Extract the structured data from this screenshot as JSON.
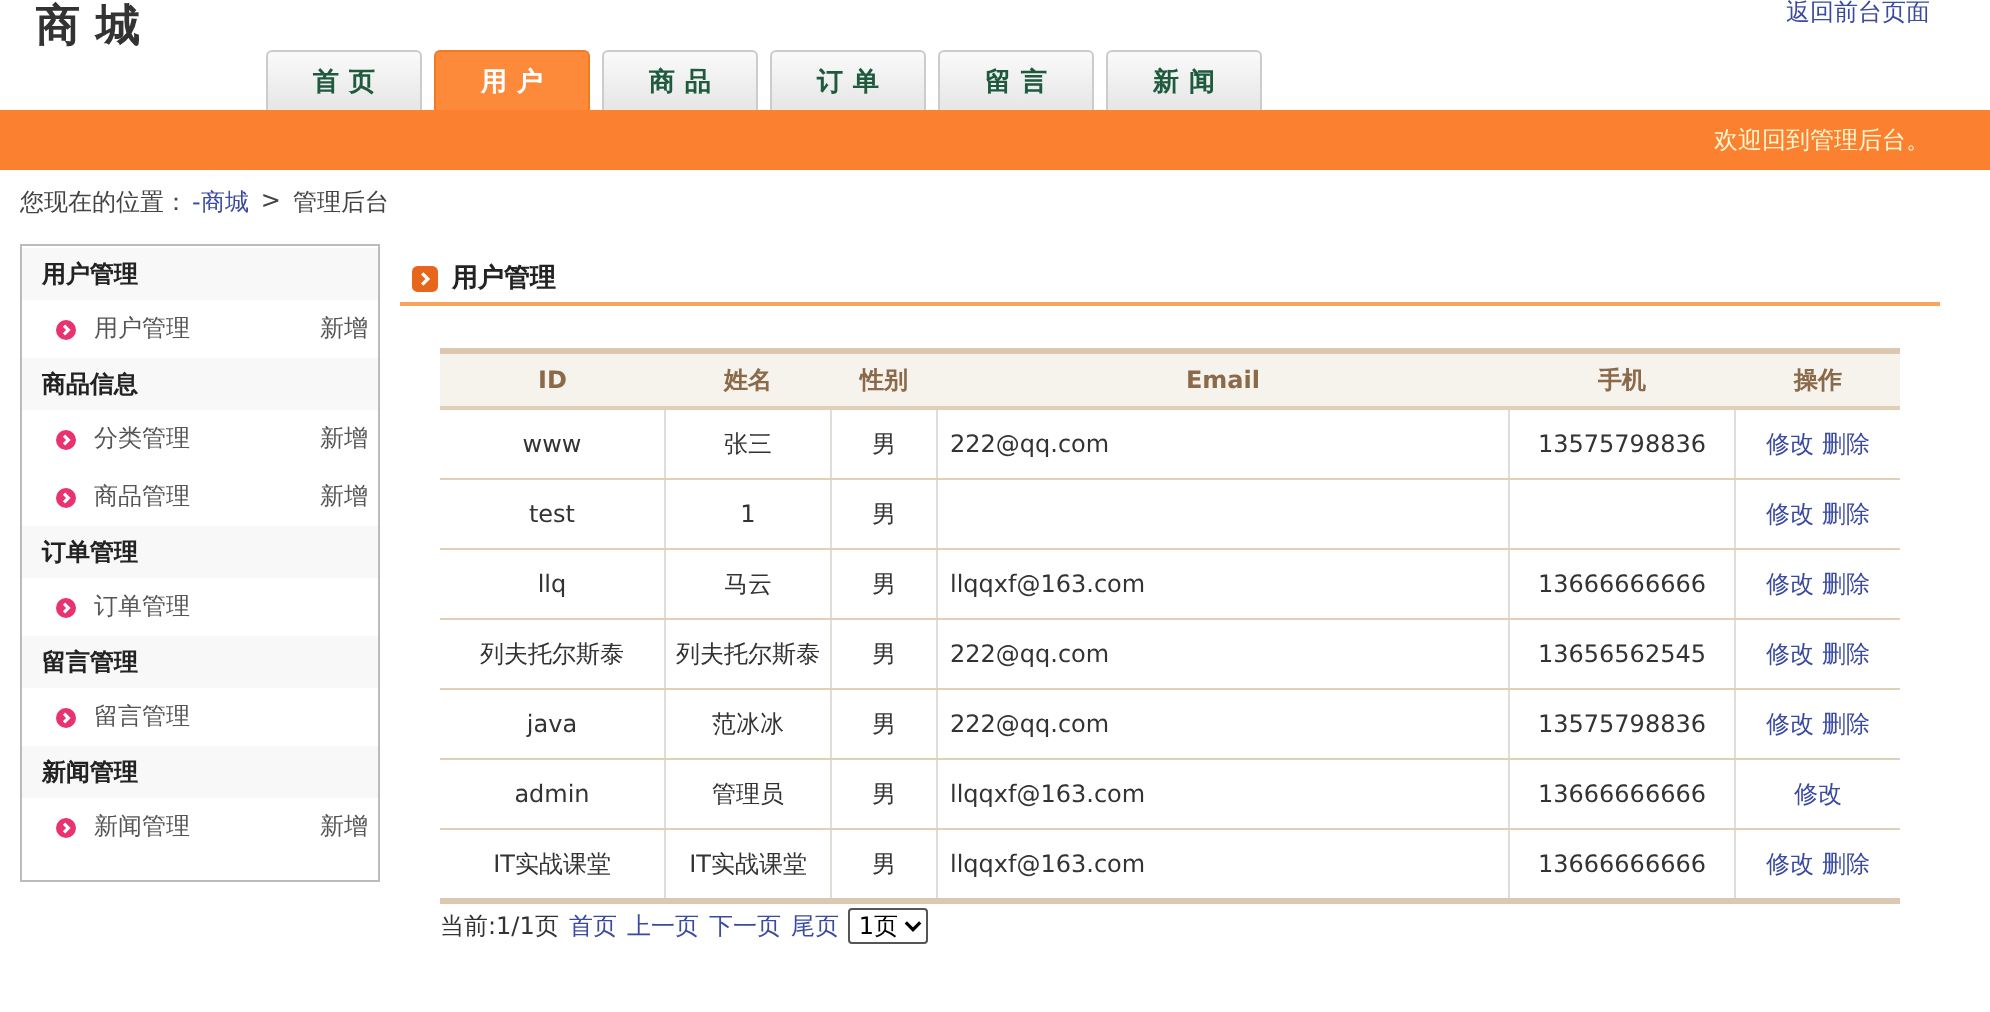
{
  "logo": "商城",
  "top_link": "返回前台页面",
  "tabs": [
    {
      "label": "首 页",
      "selected": false
    },
    {
      "label": "用 户",
      "selected": true
    },
    {
      "label": "商 品",
      "selected": false
    },
    {
      "label": "订 单",
      "selected": false
    },
    {
      "label": "留 言",
      "selected": false
    },
    {
      "label": "新 闻",
      "selected": false
    }
  ],
  "welcome": "欢迎回到管理后台。",
  "breadcrumb": {
    "prefix": "您现在的位置：",
    "link": "-商城",
    "separator": ">",
    "current": "管理后台"
  },
  "sidebar": [
    {
      "title": "用户管理",
      "items": [
        {
          "label": "用户管理",
          "action": "新增"
        }
      ]
    },
    {
      "title": "商品信息",
      "items": [
        {
          "label": "分类管理",
          "action": "新增"
        },
        {
          "label": "商品管理",
          "action": "新增"
        }
      ]
    },
    {
      "title": "订单管理",
      "items": [
        {
          "label": "订单管理"
        }
      ]
    },
    {
      "title": "留言管理",
      "items": [
        {
          "label": "留言管理"
        }
      ]
    },
    {
      "title": "新闻管理",
      "items": [
        {
          "label": "新闻管理",
          "action": "新增"
        }
      ]
    }
  ],
  "section_title": "用户管理",
  "table": {
    "columns": [
      "ID",
      "姓名",
      "性别",
      "Email",
      "手机",
      "操作"
    ],
    "rows": [
      {
        "cells": [
          "www",
          "张三",
          "男",
          "222@qq.com",
          "13575798836"
        ],
        "actions": [
          "修改",
          "删除"
        ]
      },
      {
        "cells": [
          "test",
          "1",
          "男",
          "",
          ""
        ],
        "actions": [
          "修改",
          "删除"
        ]
      },
      {
        "cells": [
          "llq",
          "马云",
          "男",
          "llqqxf@163.com",
          "13666666666"
        ],
        "actions": [
          "修改",
          "删除"
        ]
      },
      {
        "cells": [
          "列夫托尔斯泰",
          "列夫托尔斯泰",
          "男",
          "222@qq.com",
          "13656562545"
        ],
        "actions": [
          "修改",
          "删除"
        ]
      },
      {
        "cells": [
          "java",
          "范冰冰",
          "男",
          "222@qq.com",
          "13575798836"
        ],
        "actions": [
          "修改",
          "删除"
        ]
      },
      {
        "cells": [
          "admin",
          "管理员",
          "男",
          "llqqxf@163.com",
          "13666666666"
        ],
        "actions": [
          "修改"
        ]
      },
      {
        "cells": [
          "IT实战课堂",
          "IT实战课堂",
          "男",
          "llqqxf@163.com",
          "13666666666"
        ],
        "actions": [
          "修改",
          "删除"
        ]
      }
    ]
  },
  "pager": {
    "status": "当前:1/1页",
    "links": [
      "首页",
      "上一页",
      "下一页",
      "尾页"
    ],
    "select": "1页"
  }
}
